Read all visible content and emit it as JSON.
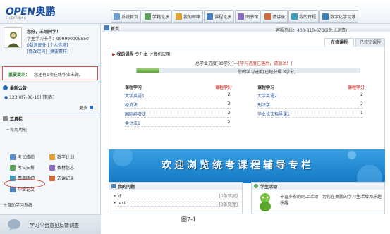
{
  "header": {
    "logo_en": "OPEN",
    "logo_cn": "奥鹏",
    "logo_sub": "E-LEARNING",
    "tabs": [
      {
        "label": "系统首页",
        "icon": "home-icon",
        "color": "#6a9fd4"
      },
      {
        "label": "学籍论坛",
        "icon": "forum-icon",
        "color": "#5ba35b"
      },
      {
        "label": "我的邮箱",
        "icon": "mail-icon",
        "color": "#e0a030"
      },
      {
        "label": "课程论坛",
        "icon": "course-forum-icon",
        "color": "#4a7fc0"
      },
      {
        "label": "图书馆",
        "icon": "library-icon",
        "color": "#8a6bbf"
      },
      {
        "label": "请讲录",
        "icon": "record-icon",
        "color": "#d06a3a"
      },
      {
        "label": "我的日程",
        "icon": "calendar-icon",
        "color": "#3a9fbf"
      },
      {
        "label": "数字化学习港",
        "icon": "harbor-icon",
        "color": "#3a7fbf"
      }
    ]
  },
  "user": {
    "greeting": "您好，王刚同学！",
    "student_id_label": "学生学习卡号：",
    "student_id": "999990000550",
    "mail_label": "0封新邮件",
    "profile_link": "[个人信息]",
    "change_password": "[修改密码]",
    "change_template": "[换要素样]"
  },
  "reminder": {
    "label": "重要提示：",
    "text": "您还有1项在线作业未做。"
  },
  "notice": {
    "title": "最新公告",
    "items": [
      {
        "text": "123 (07-06-10)",
        "tag": "[列表]"
      }
    ],
    "more": "更多"
  },
  "toolbar": {
    "title": "工具栏",
    "section": "常用功能",
    "items": [
      {
        "label": "考试成绩",
        "icon": "exam-score-icon",
        "color": "#5a8fcf"
      },
      {
        "label": "数学计划",
        "icon": "plan-icon",
        "color": "#e0a030"
      },
      {
        "label": "考试安排",
        "icon": "exam-schedule-icon",
        "color": "#5ba35b"
      },
      {
        "label": "教材信息",
        "icon": "textbook-icon",
        "color": "#8a6bbf"
      },
      {
        "label": "费用明细",
        "icon": "fee-icon",
        "color": "#3a9fbf"
      },
      {
        "label": "选课记录",
        "icon": "selection-icon",
        "color": "#d06a3a"
      },
      {
        "label": "毕业论文",
        "icon": "thesis-icon",
        "color": "#4a7fc0"
      }
    ],
    "auto_learning": "自助学习系统"
  },
  "feedback": {
    "text": "学习平台意见反馈调查"
  },
  "main": {
    "breadcrumb": "首页",
    "hotline": "客服热线：400-810-6736(免长途费)",
    "tab_active": "在修课程",
    "tab_done": "已修完课程",
    "my_course_label": "我的课程",
    "my_course_major": "专升本 计算机应用",
    "total_progress_prefix": "总学业进度[80学分]---",
    "total_progress_link": "[学习进度已落后，请加油！]",
    "my_progress": "您的学习进度[已经获得 8学分]",
    "progress_fraction": 0.1,
    "col_course": "课程学习",
    "col_credit": "课程学分",
    "left_courses": [
      {
        "name": "大学英语1",
        "credit": "2"
      },
      {
        "name": "经济法",
        "credit": "2"
      },
      {
        "name": "国际经济法",
        "credit": "2"
      },
      {
        "name": "会计法1",
        "credit": "2"
      }
    ],
    "right_courses": [
      {
        "name": "大学英语2",
        "credit": "2"
      },
      {
        "name": "刑法学",
        "credit": "2"
      },
      {
        "name": "毕业论文指导课1",
        "credit": "1"
      }
    ],
    "banner_text": "欢迎浏览统考课程辅导专栏",
    "questions_title": "我的问题",
    "questions": [
      {
        "text": "好",
        "tag": "[0条回复]"
      },
      {
        "text": "test",
        "tag": "[0条回复]"
      }
    ],
    "activity_title": "学生活动",
    "activity_text1": "丰富多彩的网上活动，为您在奥鹏的学习生活增添乐趣",
    "activity_text2": "乐趣"
  },
  "caption": "图7-1",
  "colors": {
    "accent": "#1d4f9c",
    "alert": "#d9534f",
    "banner": "#2a8dd6",
    "progress": "#6cbf3a"
  }
}
